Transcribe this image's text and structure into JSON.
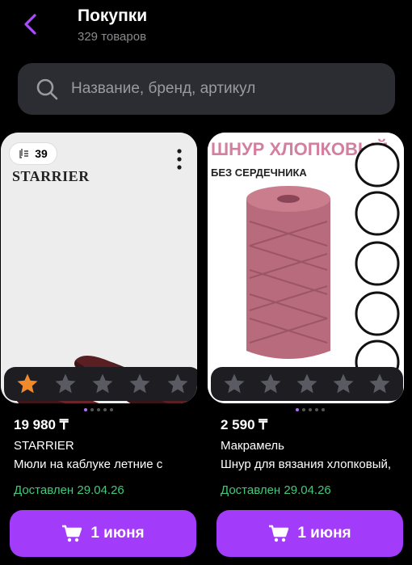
{
  "header": {
    "title": "Покупки",
    "subtitle": "329 товаров"
  },
  "search": {
    "placeholder": "Название, бренд, артикул"
  },
  "products": [
    {
      "badge_count": "39",
      "image_brand_text": "STARRIER",
      "rating_filled": 1,
      "rating_total": 5,
      "price": "19 980 ₸",
      "brand": "STARRIER",
      "description": "Мюли на каблуке летние с",
      "delivery": "Доставлен 29.04.26",
      "button_label": "1 июня"
    },
    {
      "image_title": "ШНУР ХЛОПКОВЫЙ",
      "image_subtitle": "БЕЗ СЕРДЕЧНИКА",
      "rating_filled": 0,
      "rating_total": 5,
      "price": "2 590 ₸",
      "brand": "Макрамель",
      "description": "Шнур для вязания хлопковый,",
      "delivery": "Доставлен 29.04.26",
      "button_label": "1 июня"
    }
  ],
  "colors": {
    "accent": "#a23bfa",
    "delivered": "#46c77b",
    "star_filled": "#f08a2c",
    "star_empty": "#5a5a62"
  }
}
